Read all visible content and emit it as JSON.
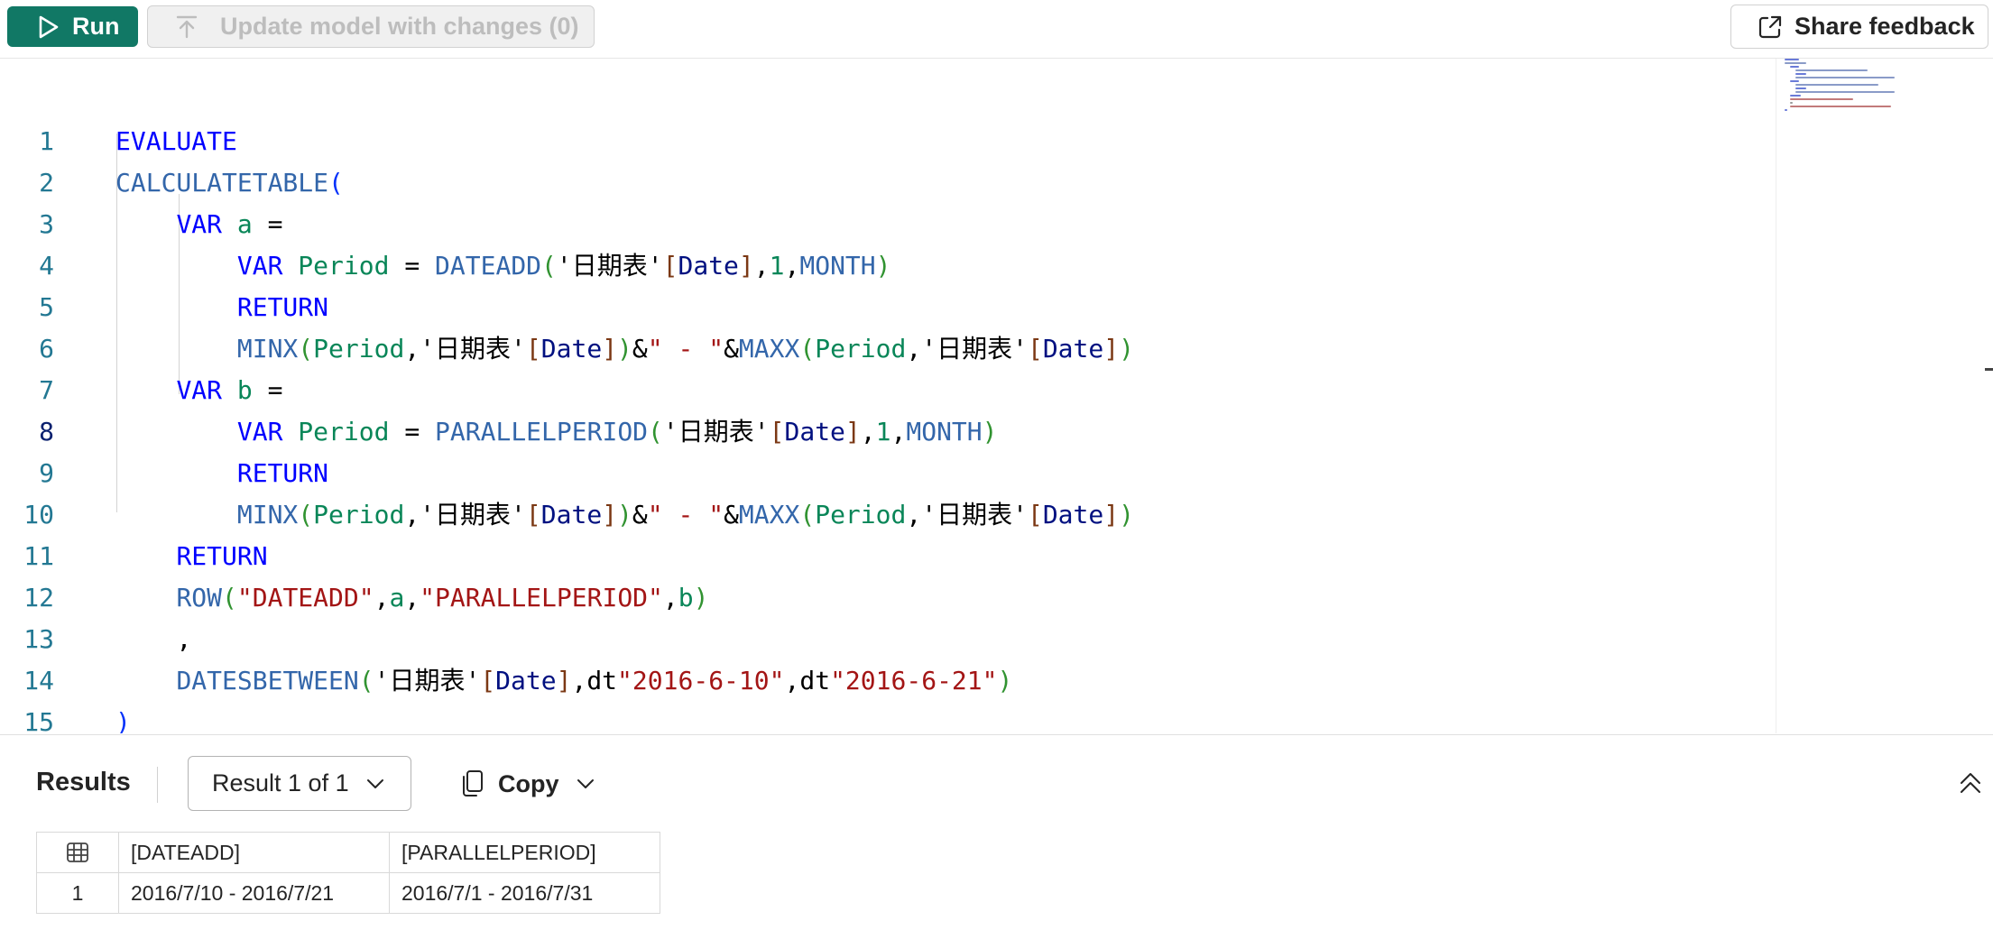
{
  "toolbar": {
    "run_label": "Run",
    "update_label": "Update model with changes (0)",
    "feedback_label": "Share feedback"
  },
  "editor": {
    "line_numbers": [
      "1",
      "2",
      "3",
      "4",
      "5",
      "6",
      "7",
      "8",
      "9",
      "10",
      "11",
      "12",
      "13",
      "14",
      "15"
    ],
    "active_line": "8"
  },
  "results": {
    "title": "Results",
    "result_selector": "Result 1 of 1",
    "copy_label": "Copy",
    "columns": [
      "[DATEADD]",
      "[PARALLELPERIOD]"
    ],
    "rows": [
      {
        "index": "1",
        "dateadd": "2016/7/10 - 2016/7/21",
        "parallelperiod": "2016/7/1 - 2016/7/31"
      }
    ]
  },
  "colors": {
    "run_button": "#117865",
    "keyword": "#0000ff",
    "function": "#3366aa",
    "variable": "#098658",
    "string": "#a31515",
    "line_number": "#237893"
  },
  "icons": [
    "play-icon",
    "upload-arrow-icon",
    "share-feedback-icon",
    "chevron-down-icon",
    "copy-icon",
    "collapse-up-icon",
    "table-grid-icon"
  ]
}
